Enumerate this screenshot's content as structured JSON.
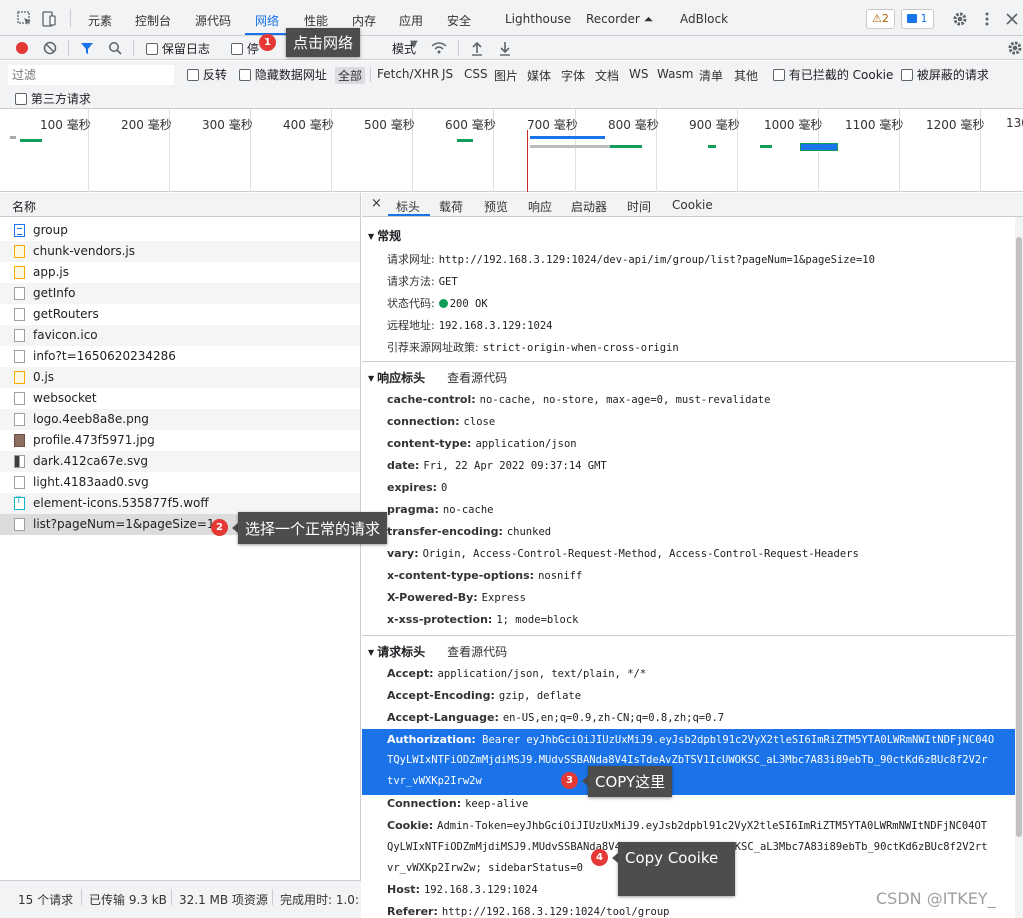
{
  "top_tabs": [
    "元素",
    "控制台",
    "源代码",
    "网络",
    "性能",
    "内存",
    "应用",
    "安全",
    "Lighthouse",
    "Recorder ⏶",
    "AdBlock"
  ],
  "top_badges": {
    "warnings": "⚠2",
    "messages": "1"
  },
  "toolbar": {
    "preserve_log": "保留日志",
    "disable_cache_partial": "停",
    "throttle_partial": "模式"
  },
  "filter": {
    "placeholder": "过滤",
    "invert": "反转",
    "hide_data_urls": "隐藏数据网址",
    "types": [
      "全部",
      "Fetch/XHR",
      "JS",
      "CSS",
      "图片",
      "媒体",
      "字体",
      "文档",
      "WS",
      "Wasm",
      "清单",
      "其他"
    ],
    "blocked_cookies": "有已拦截的 Cookie",
    "blocked_requests": "被屏蔽的请求",
    "third_party": "第三方请求"
  },
  "timeline_labels": [
    "100 毫秒",
    "200 毫秒",
    "300 毫秒",
    "400 毫秒",
    "500 毫秒",
    "600 毫秒",
    "700 毫秒",
    "800 毫秒",
    "900 毫秒",
    "1000 毫秒",
    "1100 毫秒",
    "1200 毫秒",
    "130"
  ],
  "request_list": {
    "header": "名称",
    "items": [
      {
        "name": "group",
        "icon": "doc"
      },
      {
        "name": "chunk-vendors.js",
        "icon": "js"
      },
      {
        "name": "app.js",
        "icon": "js"
      },
      {
        "name": "getInfo",
        "icon": "blank"
      },
      {
        "name": "getRouters",
        "icon": "blank"
      },
      {
        "name": "favicon.ico",
        "icon": "blank"
      },
      {
        "name": "info?t=1650620234286",
        "icon": "blank"
      },
      {
        "name": "0.js",
        "icon": "js"
      },
      {
        "name": "websocket",
        "icon": "blank"
      },
      {
        "name": "logo.4eeb8a8e.png",
        "icon": "svg"
      },
      {
        "name": "profile.473f5971.jpg",
        "icon": "img"
      },
      {
        "name": "dark.412ca67e.svg",
        "icon": "svgd"
      },
      {
        "name": "light.4183aad0.svg",
        "icon": "blank"
      },
      {
        "name": "element-icons.535877f5.woff",
        "icon": "font"
      },
      {
        "name": "list?pageNum=1&pageSize=10",
        "icon": "blank"
      }
    ]
  },
  "status_bar": [
    "15 个请求",
    "已传输 9.3 kB",
    "32.1 MB 项资源",
    "完成用时: 1.0:"
  ],
  "detail_tabs": [
    "×",
    "标头",
    "载荷",
    "预览",
    "响应",
    "启动器",
    "时间",
    "Cookie"
  ],
  "general": {
    "title": "常规",
    "rows": [
      {
        "name": "请求网址:",
        "value": "http://192.168.3.129:1024/dev-api/im/group/list?pageNum=1&pageSize=10"
      },
      {
        "name": "请求方法:",
        "value": "GET"
      },
      {
        "name": "状态代码:",
        "value": "200 OK"
      },
      {
        "name": "远程地址:",
        "value": "192.168.3.129:1024"
      },
      {
        "name": "引荐来源网址政策:",
        "value": "strict-origin-when-cross-origin"
      }
    ]
  },
  "response_headers": {
    "title": "响应标头",
    "view_source": "查看源代码",
    "rows": [
      {
        "name": "cache-control:",
        "value": "no-cache, no-store, max-age=0, must-revalidate"
      },
      {
        "name": "connection:",
        "value": "close"
      },
      {
        "name": "content-type:",
        "value": "application/json"
      },
      {
        "name": "date:",
        "value": "Fri, 22 Apr 2022 09:37:14 GMT"
      },
      {
        "name": "expires:",
        "value": "0"
      },
      {
        "name": "pragma:",
        "value": "no-cache"
      },
      {
        "name": "transfer-encoding:",
        "value": "chunked"
      },
      {
        "name": "vary:",
        "value": "Origin, Access-Control-Request-Method, Access-Control-Request-Headers"
      },
      {
        "name": "x-content-type-options:",
        "value": "nosniff"
      },
      {
        "name": "X-Powered-By:",
        "value": "Express"
      },
      {
        "name": "x-xss-protection:",
        "value": "1; mode=block"
      }
    ]
  },
  "request_headers": {
    "title": "请求标头",
    "view_source": "查看源代码",
    "accept": {
      "name": "Accept:",
      "value": "application/json, text/plain, */*"
    },
    "accept_encoding": {
      "name": "Accept-Encoding:",
      "value": "gzip, deflate"
    },
    "accept_language": {
      "name": "Accept-Language:",
      "value": "en-US,en;q=0.9,zh-CN;q=0.8,zh;q=0.7"
    },
    "authorization": {
      "name": "Authorization:",
      "line1": "Bearer eyJhbGciOiJIUzUxMiJ9.eyJsb2dpbl91c2VyX2tleSI6ImRiZTM5YTA0LWRmNWItNDFjNC04O",
      "line2": "TQyLWIxNTFiODZmMjdiMSJ9.MUdvSSBANda8V4IsTdeAvZbTSV1IcUWOKSC_aL3Mbc7A83i89ebTb_90ctKd6zBUc8f2V2r",
      "line3": "tvr_vWXKp2Irw2w"
    },
    "connection": {
      "name": "Connection:",
      "value": "keep-alive"
    },
    "cookie": {
      "name": "Cookie:",
      "line1": "Admin-Token=eyJhbGciOiJIUzUxMiJ9.eyJsb2dpbl91c2VyX2tleSI6ImRiZTM5YTA0LWRmNWItNDFjNC04OT",
      "line2": "QyLWIxNTFiODZmMjdiMSJ9.MUdvSSBANda8V4IsTdeAvZbTSV1IcUWOKSC_aL3Mbc7A83i89ebTb_90ctKd6zBUc8f2V2rt",
      "line3": "vr_vWXKp2Irw2w; sidebarStatus=0"
    },
    "host": {
      "name": "Host:",
      "value": "192.168.3.129:1024"
    },
    "referer": {
      "name": "Referer:",
      "value": "http://192.168.3.129:1024/tool/group"
    }
  },
  "annotations": [
    {
      "num": "1",
      "text": "点击网络"
    },
    {
      "num": "2",
      "text": "选择一个正常的请求"
    },
    {
      "num": "3",
      "text": "COPY这里"
    },
    {
      "num": "4",
      "text": "Copy Cooike"
    }
  ],
  "watermark": "CSDN @ITKEY_",
  "colors": {
    "accent": "#1a73e8",
    "record": "#e53935",
    "selection": "#1a73e8",
    "annotation_bg": "#4d4d4d"
  }
}
